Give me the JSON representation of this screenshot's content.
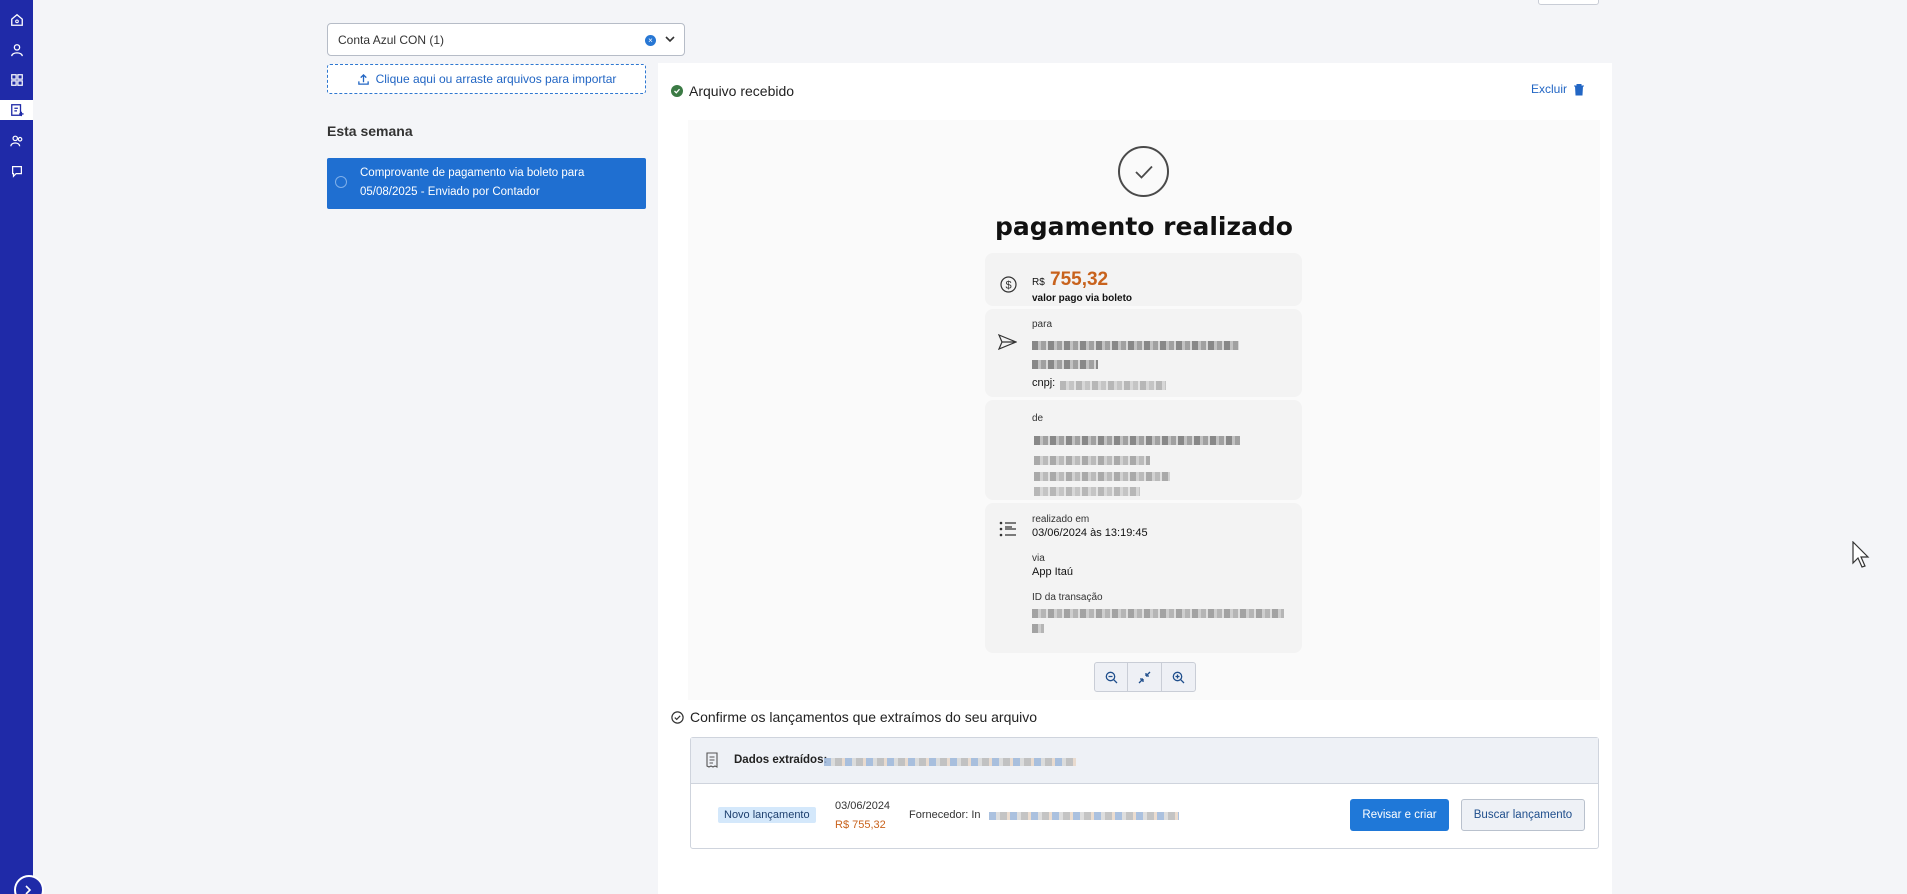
{
  "sidebar": {
    "icons": [
      "home-icon",
      "user-icon",
      "apps-icon",
      "document-add-icon",
      "people-icon",
      "chat-icon"
    ]
  },
  "left": {
    "account_select": "Conta Azul CON (1)",
    "upload_text": "Clique aqui ou arraste arquivos para importar",
    "section_title": "Esta semana",
    "items": [
      {
        "line1": "Comprovante de pagamento via boleto para",
        "line2": "05/08/2025 - Enviado por Contador"
      }
    ]
  },
  "main": {
    "received_title": "Arquivo recebido",
    "delete_label": "Excluir",
    "receipt": {
      "title": "pagamento realizado",
      "currency": "R$",
      "amount": "755,32",
      "amount_caption": "valor pago via boleto",
      "to_label": "para",
      "cnpj_label": "cnpj:",
      "from_label": "de",
      "date_label": "realizado em",
      "date_value": "03/06/2024 às 13:19:45",
      "via_label": "via",
      "via_value": "App Itaú",
      "txid_label": "ID da transação"
    },
    "confirm_title": "Confirme os lançamentos que extraímos do seu arquivo",
    "extracted_label": "Dados extraídos:",
    "entry": {
      "badge": "Novo lançamento",
      "date": "03/06/2024",
      "amount": "R$ 755,32",
      "supplier_label": "Fornecedor: In",
      "review_button": "Revisar e criar",
      "search_button": "Buscar lançamento"
    }
  },
  "colors": {
    "sidebar": "#1f2aa8",
    "primary": "#1f78d8",
    "amount": "#c8621c"
  }
}
